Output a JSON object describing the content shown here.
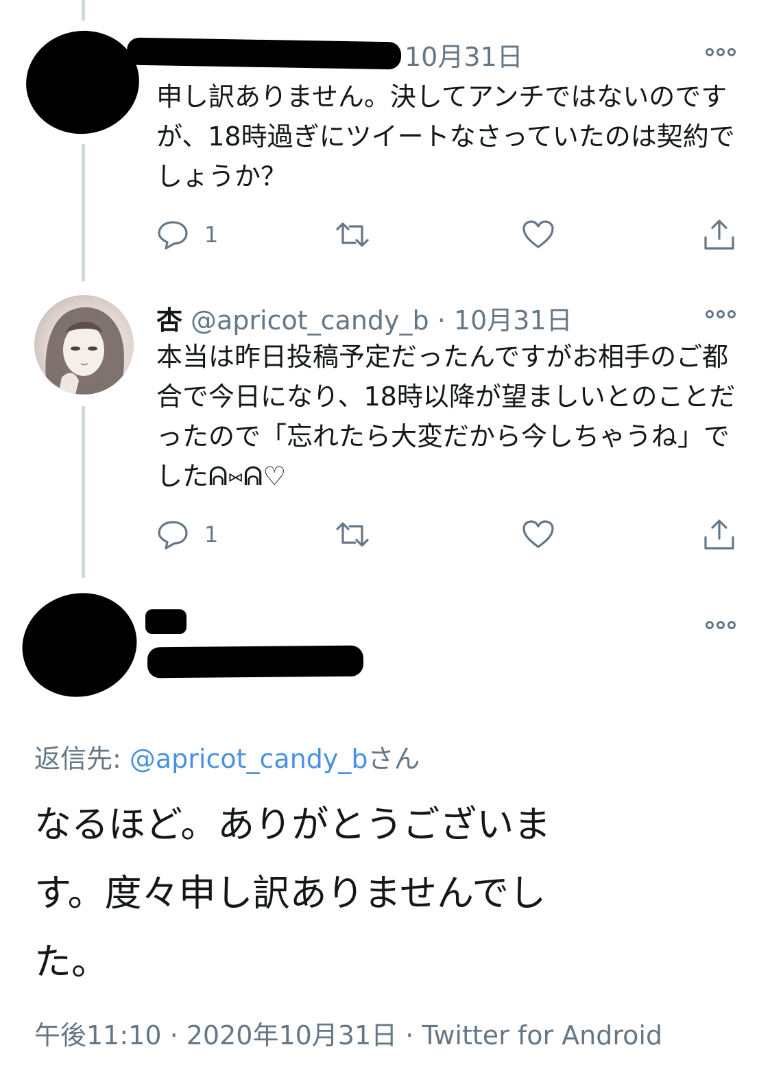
{
  "tweets": [
    {
      "time": "10月31日",
      "text": "申し訳ありません。決してアンチではないのですが、18時過ぎにツイートなさっていたのは契約でしょうか？",
      "reply_count": "1"
    },
    {
      "name": "杏",
      "handle": "@apricot_candy_b",
      "separator": "·",
      "time": "10月31日",
      "text": "本当は昨日投稿予定だったんですがお相手のご都合で今日になり、18時以降が望ましいとのことだったので「忘れたら大変だから今しちゃうね」でしたᕱ⑅ᕱ♡",
      "reply_count": "1"
    }
  ],
  "focused": {
    "reply_prefix": "返信先: ",
    "reply_handle": "@apricot_candy_b",
    "reply_suffix": "さん",
    "text": "なるほど。ありがとうございま\nす。度々申し訳ありませんでし\nた。",
    "timestamp": "午後11:10 · 2020年10月31日 · Twitter for Android"
  },
  "icons": [
    "reply-icon",
    "retweet-icon",
    "like-icon",
    "share-icon",
    "more-icon"
  ]
}
